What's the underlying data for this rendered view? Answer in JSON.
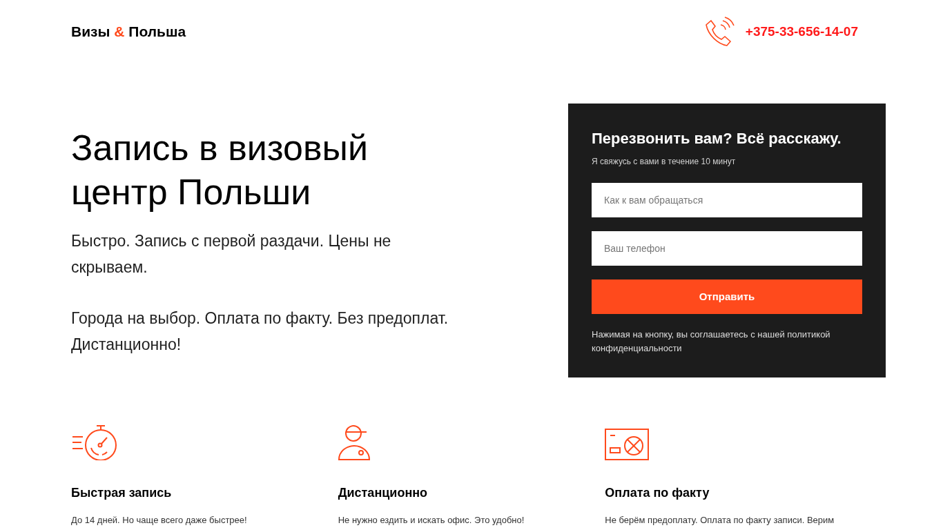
{
  "header": {
    "logo": {
      "before": "Визы",
      "amp": "&",
      "after": "Польша"
    },
    "phone": "+375-33-656-14-07"
  },
  "hero": {
    "title": "Запись в визовый центр Польши",
    "paragraphs": [
      "Быстро. Запись с первой раздачи. Цены не скрываем.",
      "Города на выбор. Оплата по факту. Без предоплат. Дистанционно!"
    ]
  },
  "form": {
    "title": "Перезвонить вам? Всё расскажу.",
    "subtitle": "Я свяжусь с вами в течение 10 минут",
    "fields": [
      {
        "placeholder": "Как к вам обращаться"
      },
      {
        "placeholder": "Ваш телефон"
      }
    ],
    "button": "Отправить",
    "note": "Нажимая на кнопку, вы соглашаетесь с нашей политикой конфиденциальности"
  },
  "features": [
    {
      "kind": "stopwatch",
      "title": "Быстрая запись",
      "text": "До 14 дней. Но чаще всего даже быстрее!"
    },
    {
      "kind": "person",
      "title": "Дистанционно",
      "text": "Не нужно ездить и искать офис. Это удобно!"
    },
    {
      "kind": "card",
      "title": "Оплата по факту",
      "text": "Не берём предоплату. Оплата по факту записи. Верим"
    }
  ]
}
